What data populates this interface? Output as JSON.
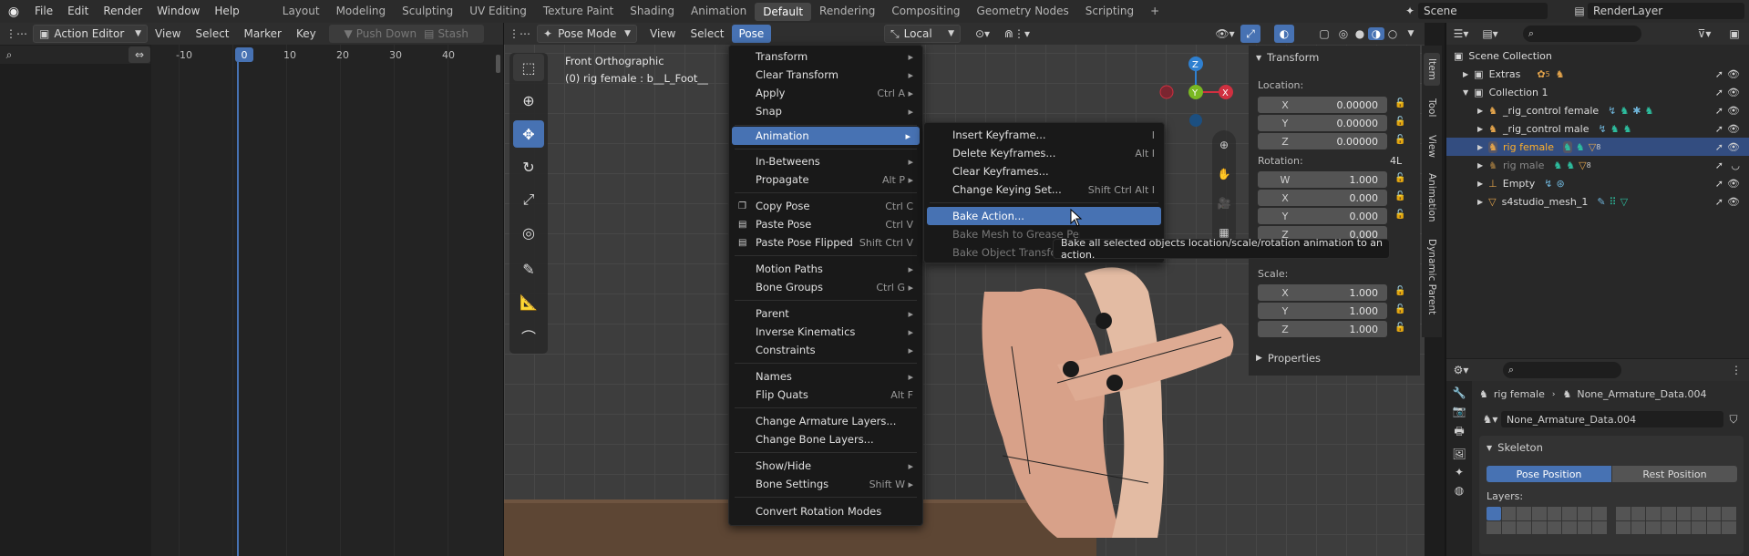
{
  "topbar": {
    "menus": [
      "File",
      "Edit",
      "Render",
      "Window",
      "Help"
    ],
    "workspaces": [
      "Layout",
      "Modeling",
      "Sculpting",
      "UV Editing",
      "Texture Paint",
      "Shading",
      "Animation",
      "Default",
      "Rendering",
      "Compositing",
      "Geometry Nodes",
      "Scripting"
    ],
    "active_workspace": "Default",
    "add_tab": "+",
    "scene": "Scene",
    "render_layer": "RenderLayer"
  },
  "action_editor": {
    "mode": "Action Editor",
    "menus": [
      "View",
      "Select",
      "Marker",
      "Key"
    ],
    "push_down": "Push Down",
    "stash": "Stash",
    "frames": [
      "-10",
      "0",
      "10",
      "20",
      "30",
      "40"
    ],
    "current_frame": "0"
  },
  "viewport": {
    "mode": "Pose Mode",
    "menus": [
      "View",
      "Select",
      "Pose"
    ],
    "view_name": "Front Orthographic",
    "object_info": "(0) rig female : b__L_Foot__",
    "orientation": "Local",
    "axes": {
      "z": "Z",
      "y": "Y",
      "x": "X"
    }
  },
  "pose_menu": {
    "items": [
      {
        "label": "Transform",
        "shortcut": "",
        "arrow": true
      },
      {
        "label": "Clear Transform",
        "shortcut": "",
        "arrow": true
      },
      {
        "label": "Apply",
        "shortcut": "Ctrl A",
        "arrow": true
      },
      {
        "label": "Snap",
        "shortcut": "",
        "arrow": true
      },
      {
        "label": "Animation",
        "shortcut": "",
        "arrow": true
      },
      {
        "label": "In-Betweens",
        "shortcut": "",
        "arrow": true
      },
      {
        "label": "Propagate",
        "shortcut": "Alt P",
        "arrow": true
      },
      {
        "label": "Copy Pose",
        "shortcut": "Ctrl C",
        "arrow": false
      },
      {
        "label": "Paste Pose",
        "shortcut": "Ctrl V",
        "arrow": false
      },
      {
        "label": "Paste Pose Flipped",
        "shortcut": "Shift Ctrl V",
        "arrow": false
      },
      {
        "label": "Motion Paths",
        "shortcut": "",
        "arrow": true
      },
      {
        "label": "Bone Groups",
        "shortcut": "Ctrl G",
        "arrow": true
      },
      {
        "label": "Parent",
        "shortcut": "",
        "arrow": true
      },
      {
        "label": "Inverse Kinematics",
        "shortcut": "",
        "arrow": true
      },
      {
        "label": "Constraints",
        "shortcut": "",
        "arrow": true
      },
      {
        "label": "Names",
        "shortcut": "",
        "arrow": true
      },
      {
        "label": "Flip Quats",
        "shortcut": "Alt F",
        "arrow": false
      },
      {
        "label": "Change Armature Layers...",
        "shortcut": "",
        "arrow": false
      },
      {
        "label": "Change Bone Layers...",
        "shortcut": "",
        "arrow": false
      },
      {
        "label": "Show/Hide",
        "shortcut": "",
        "arrow": true
      },
      {
        "label": "Bone Settings",
        "shortcut": "Shift W",
        "arrow": true
      },
      {
        "label": "Convert Rotation Modes",
        "shortcut": "",
        "arrow": false
      }
    ]
  },
  "anim_submenu": {
    "items": [
      {
        "label": "Insert Keyframe...",
        "shortcut": "I"
      },
      {
        "label": "Delete Keyframes...",
        "shortcut": "Alt I"
      },
      {
        "label": "Clear Keyframes...",
        "shortcut": ""
      },
      {
        "label": "Change Keying Set...",
        "shortcut": "Shift Ctrl Alt I"
      },
      {
        "label": "Bake Action...",
        "shortcut": ""
      },
      {
        "label": "Bake Mesh to Grease Pencil...",
        "shortcut": ""
      },
      {
        "label": "Bake Object Transform to Grease Pencil...",
        "shortcut": ""
      }
    ]
  },
  "tooltip": "Bake all selected objects location/scale/rotation animation to an action.",
  "npanel": {
    "title": "Transform",
    "location_label": "Location:",
    "location": [
      {
        "axis": "X",
        "value": "0.00000"
      },
      {
        "axis": "Y",
        "value": "0.00000"
      },
      {
        "axis": "Z",
        "value": "0.00000"
      }
    ],
    "rotation_label": "Rotation:",
    "rotation_mode": "4L",
    "rotation": [
      {
        "axis": "W",
        "value": "1.000"
      },
      {
        "axis": "X",
        "value": "0.000"
      },
      {
        "axis": "Y",
        "value": "0.000"
      },
      {
        "axis": "Z",
        "value": "0.000"
      }
    ],
    "scale_label": "Scale:",
    "scale": [
      {
        "axis": "X",
        "value": "1.000"
      },
      {
        "axis": "Y",
        "value": "1.000"
      },
      {
        "axis": "Z",
        "value": "1.000"
      }
    ],
    "properties": "Properties",
    "tabs": [
      "Item",
      "Tool",
      "View",
      "Animation",
      "Dynamic Parent"
    ]
  },
  "outliner": {
    "items": [
      {
        "label": "Scene Collection",
        "indent": 0
      },
      {
        "label": "Extras",
        "indent": 1
      },
      {
        "label": "Collection 1",
        "indent": 1
      },
      {
        "label": "_rig_control female",
        "indent": 2
      },
      {
        "label": "_rig_control male",
        "indent": 2
      },
      {
        "label": "rig female",
        "indent": 2
      },
      {
        "label": "rig male",
        "indent": 2
      },
      {
        "label": "Empty",
        "indent": 2
      },
      {
        "label": "s4studio_mesh_1",
        "indent": 2
      }
    ],
    "selected": "rig female",
    "extras_count": "5",
    "rig_female_count": "8",
    "rig_male_count": "8"
  },
  "properties_editor": {
    "object": "rig female",
    "data": "None_Armature_Data.004",
    "data_field": "None_Armature_Data.004",
    "section": "Skeleton",
    "pose_position": "Pose Position",
    "rest_position": "Rest Position",
    "layers_label": "Layers:"
  },
  "colors": {
    "accent": "#4772b3",
    "header": "#2b2b2b",
    "panel": "#303030",
    "viewport_bg": "#3d3d3d"
  }
}
